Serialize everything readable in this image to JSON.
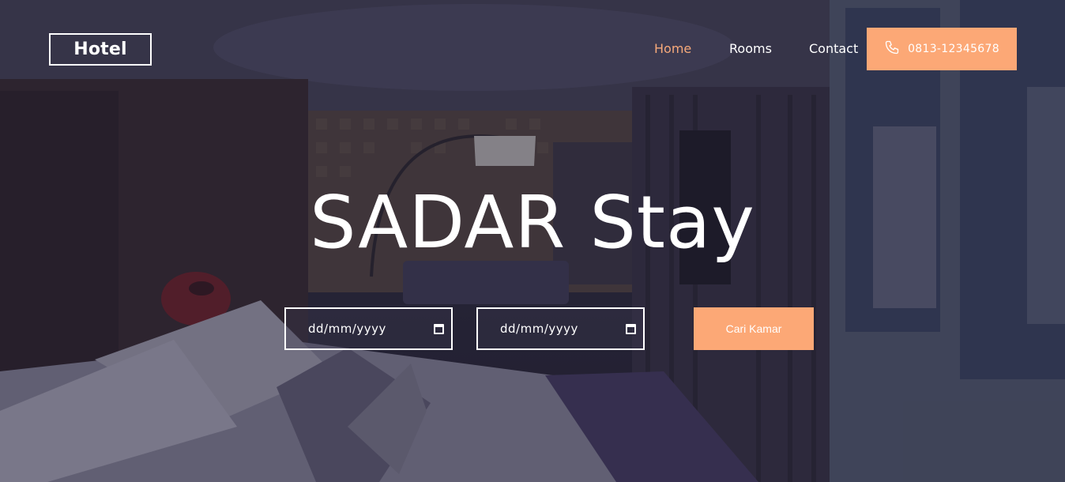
{
  "header": {
    "logo": "Hotel",
    "nav": [
      "Home",
      "Rooms",
      "Contact"
    ],
    "active_nav": "Home",
    "phone": "0813-12345678",
    "phone_icon": "phone-icon"
  },
  "hero": {
    "title": "SADAR Stay",
    "checkin_placeholder": "dd/mm/yyyy",
    "checkout_placeholder": "dd/mm/yyyy",
    "search_button": "Cari Kamar",
    "calendar_icon": "calendar-icon"
  },
  "colors": {
    "accent": "#fca876",
    "active_link": "#f6a97a",
    "text": "#ffffff"
  }
}
